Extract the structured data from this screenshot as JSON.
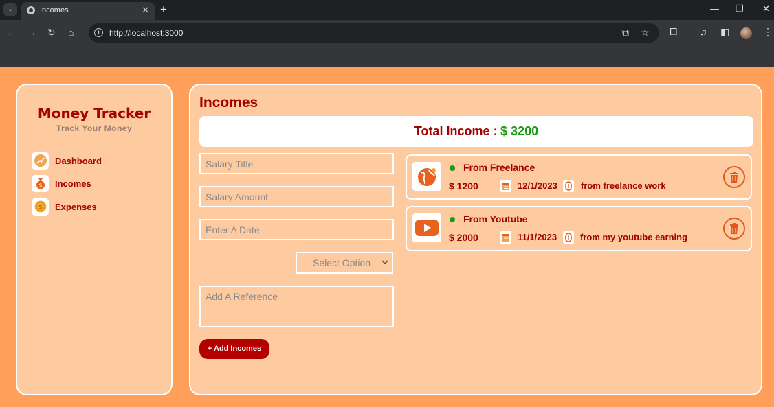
{
  "browser": {
    "tab_title": "Incomes",
    "url": "http://localhost:3000",
    "icons": [
      "tab-search-icon",
      "globe-icon",
      "close-icon",
      "plus-icon",
      "minimize-icon",
      "restore-icon",
      "close-window-icon",
      "back-icon",
      "forward-icon",
      "reload-icon",
      "home-icon",
      "info-icon",
      "open-in-app-icon",
      "star-icon",
      "extensions-icon",
      "media-icon",
      "side-panel-icon",
      "avatar",
      "menu-icon"
    ]
  },
  "sidebar": {
    "title": "Money Tracker",
    "subtitle": "Track Your Money",
    "items": [
      {
        "label": "Dashboard",
        "icon": "chart-icon"
      },
      {
        "label": "Incomes",
        "icon": "money-bag-icon"
      },
      {
        "label": "Expenses",
        "icon": "coin-icon"
      }
    ]
  },
  "main": {
    "title": "Incomes",
    "total_label": "Total Income :",
    "total_value": "$ 3200",
    "form": {
      "title_placeholder": "Salary Title",
      "amount_placeholder": "Salary Amount",
      "date_placeholder": "Enter A Date",
      "select_value": "Select Option",
      "reference_placeholder": "Add A Reference",
      "submit_label": "+ Add Incomes"
    },
    "incomes": [
      {
        "title": "From Freelance",
        "amount": "$ 1200",
        "date": "12/1/2023",
        "reference": "from freelance work",
        "icon": "globe-icon"
      },
      {
        "title": "From Youtube",
        "amount": "$ 2000",
        "date": "11/1/2023",
        "reference": "from my youtube earning",
        "icon": "youtube-icon"
      }
    ]
  },
  "colors": {
    "page_bg": "#ff9f5a",
    "panel_bg": "#fecba1",
    "accent_red": "#a30000",
    "button_red": "#b30000",
    "income_green": "#1a9b1a"
  }
}
